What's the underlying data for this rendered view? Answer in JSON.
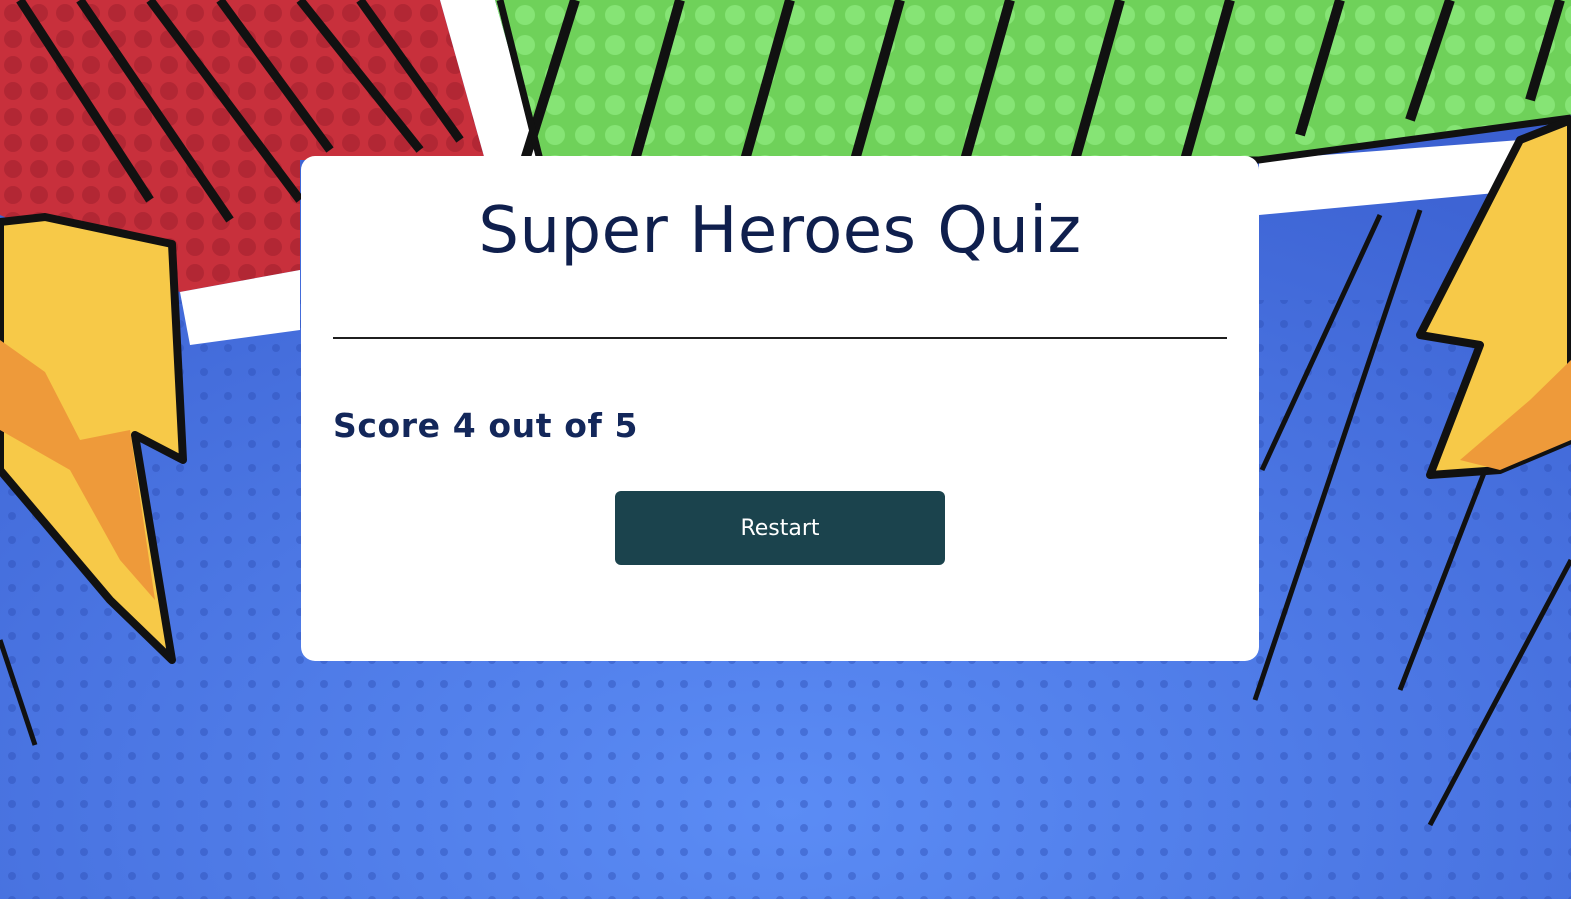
{
  "quiz": {
    "title": "Super Heroes Quiz",
    "score_text": "Score 4 out of 5",
    "restart_label": "Restart"
  },
  "background": {
    "style": "comic-burst",
    "colors": {
      "red": "#c8303c",
      "green": "#6fd15a",
      "blue": "#4f7ee8",
      "lightning_yellow": "#f7c948",
      "lightning_orange": "#ee9a3a"
    },
    "decorations": [
      "lightning-bolt-icon",
      "lightning-bolt-icon"
    ]
  },
  "theme": {
    "card_bg": "#ffffff",
    "title_color": "#0f1f4d",
    "button_bg": "#1b434d",
    "button_text": "#ffffff"
  }
}
